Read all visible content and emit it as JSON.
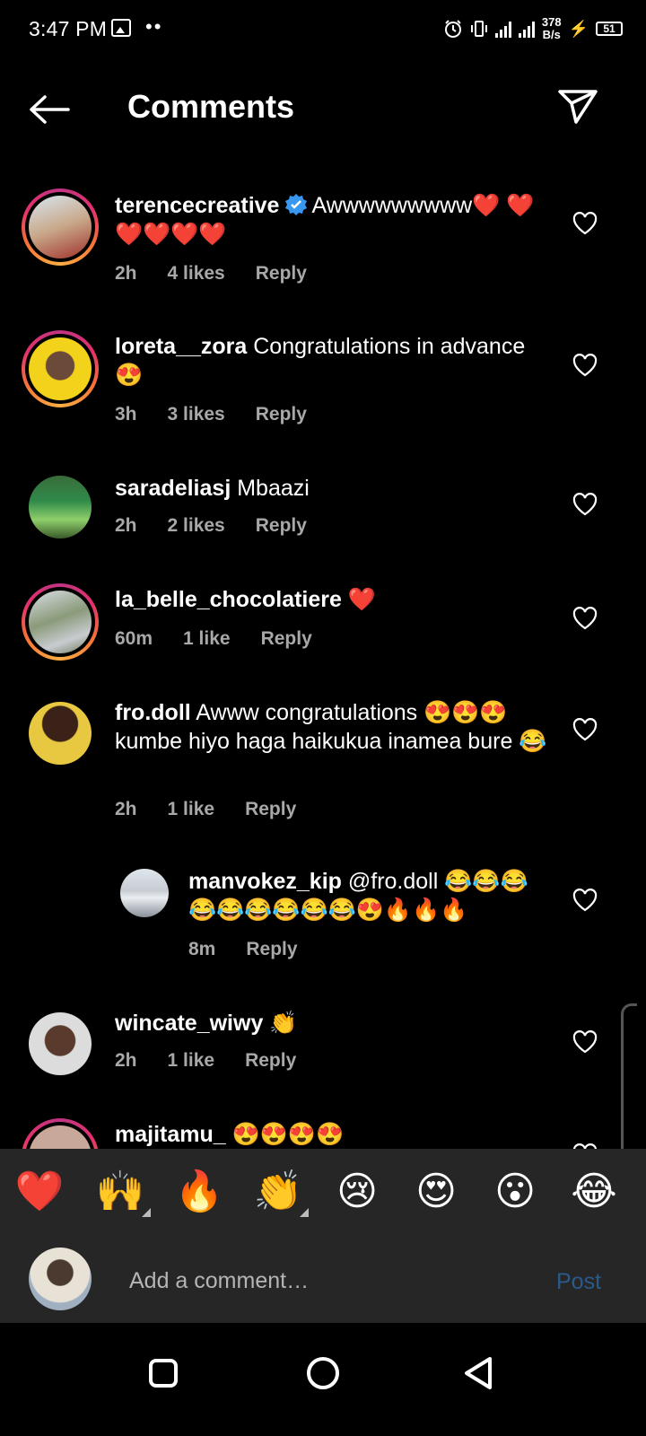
{
  "status_bar": {
    "time": "3:47 PM",
    "dots": "••",
    "speed_value": "378",
    "speed_unit": "B/s",
    "battery": "51",
    "icons": [
      "gallery-icon",
      "alarm-icon",
      "vibrate-icon",
      "signal-icon",
      "battery-icon"
    ]
  },
  "header": {
    "title": "Comments",
    "back_icon": "arrow-left-icon",
    "send_icon": "paper-plane-icon"
  },
  "comments": [
    {
      "username": "terencecreative",
      "verified": true,
      "text": "Awwwwwwwww❤️ ❤️❤️❤️❤️❤️",
      "time": "2h",
      "likes": "4 likes",
      "reply": "Reply"
    },
    {
      "username": "loreta__zora",
      "text": "Congratulations in advance 😍",
      "time": "3h",
      "likes": "3 likes",
      "reply": "Reply"
    },
    {
      "username": "saradeliasj",
      "text": "Mbaazi",
      "time": "2h",
      "likes": "2 likes",
      "reply": "Reply"
    },
    {
      "username": "la_belle_chocolatiere",
      "text": "❤️",
      "time": "60m",
      "likes": "1 like",
      "reply": "Reply"
    },
    {
      "username": "fro.doll",
      "text": "Awww congratulations 😍😍😍 kumbe hiyo haga haikukua inamea bure 😂",
      "time": "2h",
      "likes": "1 like",
      "reply": "Reply"
    },
    {
      "username": "manvokez_kip",
      "text": "@fro.doll 😂😂😂 😂😂😂😂😂😂😍🔥🔥🔥",
      "time": "8m",
      "reply": "Reply",
      "is_reply": true
    },
    {
      "username": "wincate_wiwy",
      "text": "👏",
      "time": "2h",
      "likes": "1 like",
      "reply": "Reply"
    },
    {
      "username": "majitamu_",
      "text": "😍😍😍😍"
    }
  ],
  "reactions": [
    "❤️",
    "🙌",
    "🔥",
    "👏",
    "😢",
    "😍",
    "😮",
    "😂"
  ],
  "composer": {
    "placeholder": "Add a comment…",
    "post_label": "Post"
  },
  "nav": {
    "icons": [
      "recents-square-icon",
      "home-circle-icon",
      "back-triangle-icon"
    ]
  },
  "colors": {
    "background": "#000000",
    "secondary_text": "#a8a8a8",
    "bar_background": "#262626",
    "post_disabled": "#2a5a8a",
    "verified_blue": "#3897f0"
  }
}
